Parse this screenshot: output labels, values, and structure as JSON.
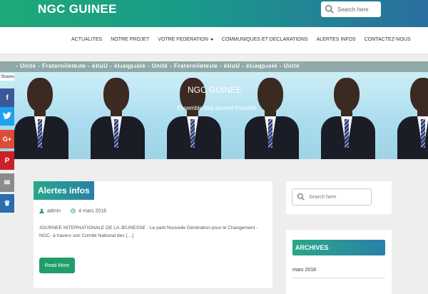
{
  "header": {
    "site_title": "NGC GUINEE",
    "search_placeholder": "Search here"
  },
  "nav": {
    "items": [
      {
        "label": "ACTUALITES"
      },
      {
        "label": "NOTRE PROJET"
      },
      {
        "label": "VOTRE FEDERATION",
        "has_dropdown": true
      },
      {
        "label": "COMMUNIQUES ET DECLARATIONS"
      },
      {
        "label": "ALERTES INFOS"
      },
      {
        "label": "CONTACTEZ-NOUS"
      }
    ]
  },
  "ticker": {
    "text": "- Unité - Fraterniiɐʇɐɹʇɐ - ėʇiuU - ėʇɹǝqpɹǝʇé - Unité - Fraterniiɐʇɐɹʇɐ - ėʇiuU - ėʇɹǝqpɹǝʇé - Unité"
  },
  "banner": {
    "title": "NGC GUINEE",
    "subtitle": "Ensemble tout devient Possible"
  },
  "share": {
    "label": "Shares",
    "buttons": [
      {
        "icon": "facebook-icon",
        "glyph": "f",
        "color": "#3b5998"
      },
      {
        "icon": "twitter-icon",
        "glyph": "t",
        "color": "#1da1f2"
      },
      {
        "icon": "google-plus-icon",
        "glyph": "G+",
        "color": "#dd4b39"
      },
      {
        "icon": "pinterest-icon",
        "glyph": "P",
        "color": "#cb2027"
      },
      {
        "icon": "email-icon",
        "glyph": "✉",
        "color": "#8b8b8b"
      },
      {
        "icon": "crown-icon",
        "glyph": "♛",
        "color": "#2b6cb0"
      }
    ]
  },
  "post": {
    "category": "Alertes infos",
    "author": "admin",
    "date": "4 mars 2018",
    "excerpt": "JOURNEE INTERNATIONALE DE LA JEUNESSE : Le parti Nouvelle Génération pour le Changement -NGC- à travers son Comité National des […]",
    "read_more": "Read More"
  },
  "sidebar": {
    "search_placeholder": "Search here",
    "archives_title": "ARCHIVES",
    "archives": [
      "mars 2018"
    ]
  },
  "colors": {
    "brand_green": "#1fa978",
    "brand_blue": "#2a6fa0",
    "button_green": "#1f9e6a"
  }
}
